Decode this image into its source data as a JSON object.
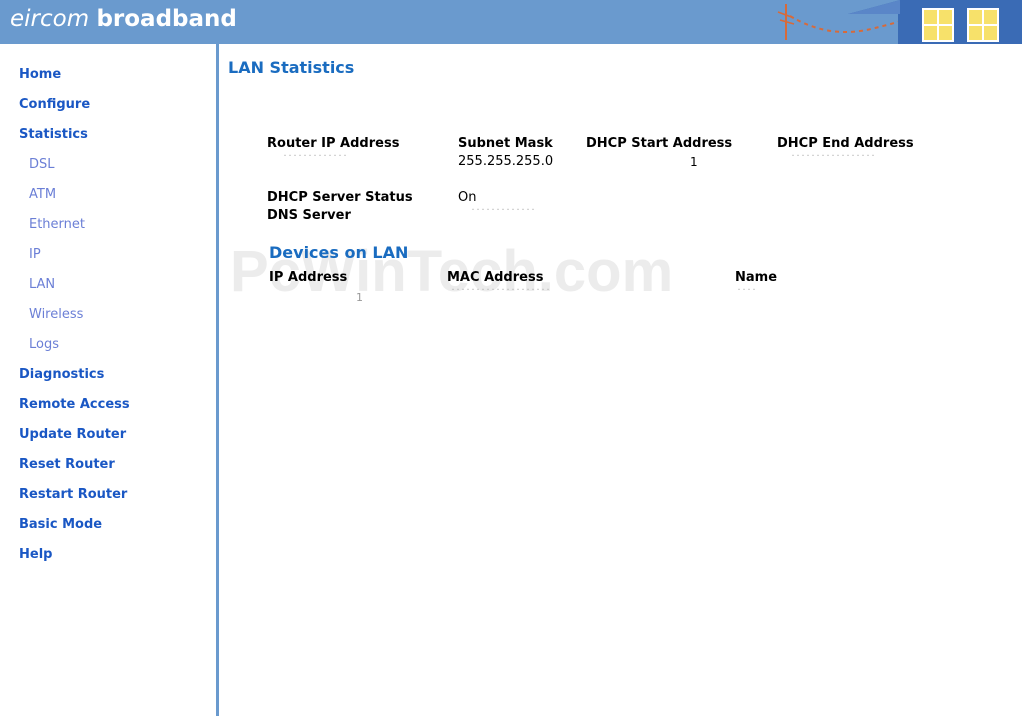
{
  "header": {
    "brand_light": "eircom",
    "brand_bold": "broadband",
    "bg_color": "#6a9ace"
  },
  "sidebar": {
    "items": [
      {
        "label": "Home"
      },
      {
        "label": "Configure"
      },
      {
        "label": "Statistics"
      },
      {
        "label": "DSL"
      },
      {
        "label": "ATM"
      },
      {
        "label": "Ethernet"
      },
      {
        "label": "IP"
      },
      {
        "label": "LAN"
      },
      {
        "label": "Wireless"
      },
      {
        "label": "Logs"
      },
      {
        "label": "Diagnostics"
      },
      {
        "label": "Remote Access"
      },
      {
        "label": "Update Router"
      },
      {
        "label": "Reset Router"
      },
      {
        "label": "Restart Router"
      },
      {
        "label": "Basic Mode"
      },
      {
        "label": "Help"
      }
    ]
  },
  "main": {
    "title": "LAN Statistics",
    "router_ip_label": "Router IP Address",
    "router_ip_value": "˙˙˙˙˙˙˙˙˙˙˙˙˙",
    "subnet_mask_label": "Subnet Mask",
    "subnet_mask_value": "255.255.255.0",
    "dhcp_start_label": "DHCP Start Address",
    "dhcp_start_value": "1",
    "dhcp_end_label": "DHCP End Address",
    "dhcp_end_value": "˙˙˙˙˙˙˙˙˙˙˙˙˙˙˙˙˙",
    "dhcp_server_status_label": "DHCP Server Status",
    "dhcp_server_status_value": "On",
    "dns_server_label": "DNS Server",
    "dns_server_value": "˙˙˙˙˙˙˙˙˙˙˙˙˙",
    "devices_title": "Devices on LAN",
    "devices_columns": [
      "IP Address",
      "MAC Address",
      "Name"
    ],
    "devices_rows": [
      [
        "1",
        "˙˙˙˙˙˙˙˙˙˙˙˙˙˙˙˙˙˙˙˙",
        "˙˙˙˙"
      ]
    ]
  },
  "watermark": "PcWinTech.com"
}
